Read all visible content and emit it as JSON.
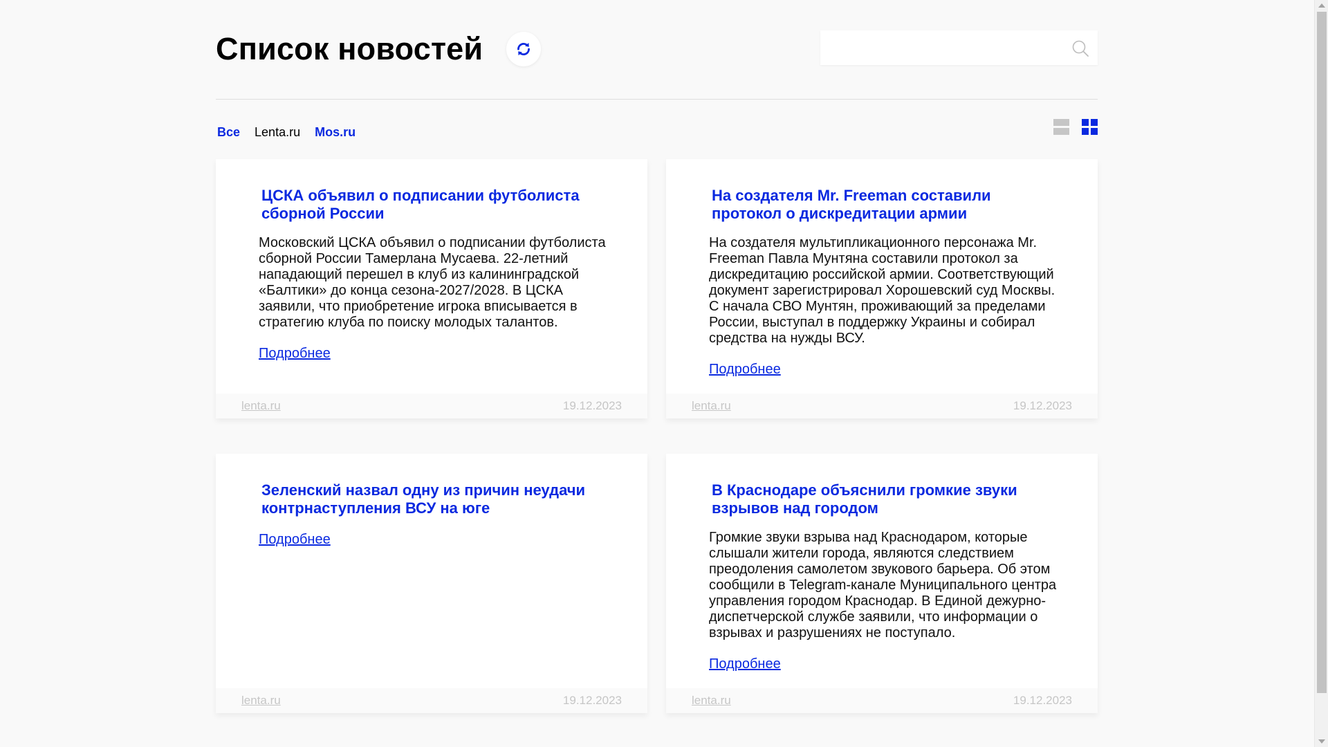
{
  "header": {
    "title": "Список новостей",
    "refresh_icon": "refresh-icon",
    "search": {
      "placeholder": "",
      "value": "",
      "icon": "search-icon"
    }
  },
  "filters": {
    "tabs": [
      {
        "label": "Все",
        "active": false
      },
      {
        "label": "Lenta.ru",
        "active": true
      },
      {
        "label": "Mos.ru",
        "active": false
      }
    ],
    "view_modes": [
      "list-view-icon",
      "grid-view-icon"
    ],
    "selected_view": "grid"
  },
  "colors": {
    "accent": "#0a29e0",
    "background": "#f9f9f9",
    "card": "#ffffff",
    "muted": "#c6c6c6"
  },
  "news": [
    {
      "title": "ЦСКА объявил о подписании футболиста сборной России",
      "text": "Московский ЦСКА объявил о подписании футболиста сборной России Тамерлана Мусаева. 22-летний нападающий перешел в клуб из калининградской «Балтики» до конца сезона-2027/2028. В ЦСКА заявили, что приобретение игрока вписывается в стратегию клуба по поиску молодых талантов.",
      "link": "Подробнее",
      "source": "lenta.ru",
      "date": "19.12.2023"
    },
    {
      "title": "На создателя Mr. Freeman составили протокол о дискредитации армии",
      "text": "На создателя мультипликационного персонажа Mr. Freeman Павла Мунтяна составили протокол за дискредитацию российской армии. Соответствующий документ зарегистрировал Хорошевский суд Москвы. С начала СВО Мунтян, проживающий за пределами России, выступал в поддержку Украины и собирал средства на нужды ВСУ.",
      "link": "Подробнее",
      "source": "lenta.ru",
      "date": "19.12.2023"
    },
    {
      "title": "Зеленский назвал одну из причин неудачи контрнаступления ВСУ на юге",
      "text": "",
      "link": "Подробнее",
      "source": "lenta.ru",
      "date": "19.12.2023"
    },
    {
      "title": "В Краснодаре объяснили громкие звуки взрывов над городом",
      "text": "Громкие звуки взрыва над Краснодаром, которые слышали жители города, являются следствием преодоления самолетом звукового барьера. Об этом сообщили в Telegram-канале Муниципального центра управления городом Краснодар. В Единой дежурно-диспетчерской службе заявили, что информации о взрывах и разрушениях не поступало.",
      "link": "Подробнее",
      "source": "lenta.ru",
      "date": "19.12.2023"
    }
  ]
}
